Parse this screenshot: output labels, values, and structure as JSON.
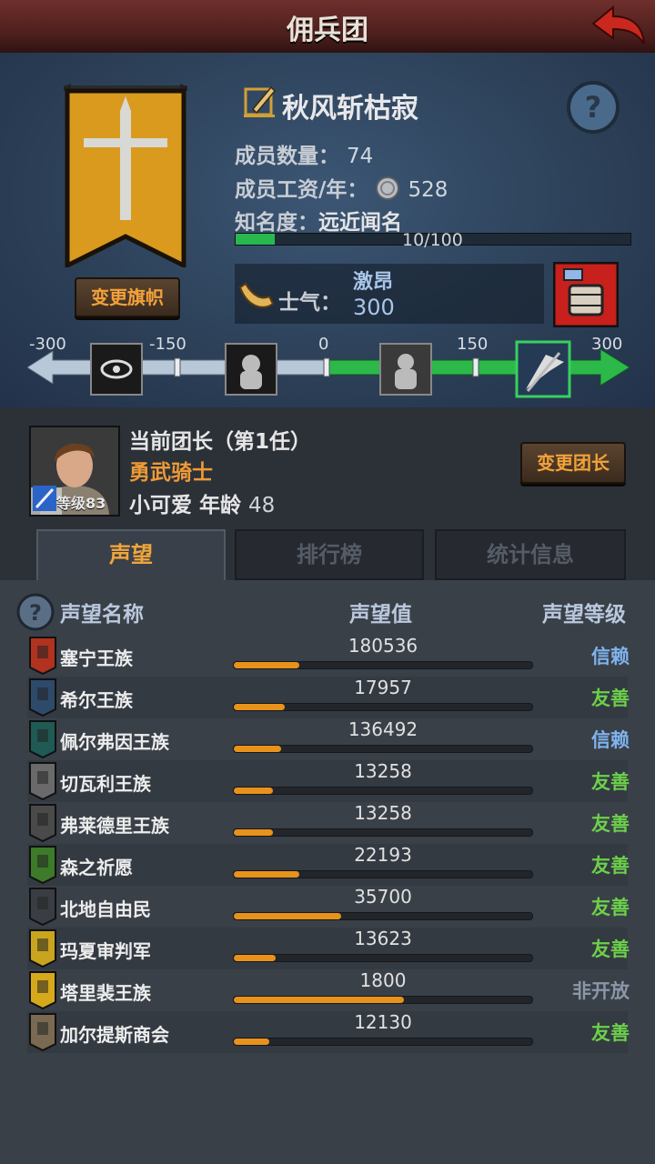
{
  "title": "佣兵团",
  "company": {
    "name": "秋风斩枯寂",
    "change_banner_label": "变更旗帜",
    "members_label": "成员数量：",
    "members_value": "74",
    "wage_label": "成员工资/年：",
    "wage_value": "528",
    "fame_label": "知名度：",
    "fame_value": "远近闻名",
    "fame_progress_text": "10/100",
    "fame_progress": 0.1,
    "morale_label": "士气：",
    "morale_word": "激昂",
    "morale_value": "300"
  },
  "morale_scale": {
    "ticks": [
      "-300",
      "-150",
      "0",
      "150",
      "300"
    ],
    "current": 300,
    "min": -300,
    "max": 300
  },
  "leader": {
    "title": "当前团长（第1任）",
    "class": "勇武骑士",
    "name_age": "小可爱  年龄",
    "age": "48",
    "level_label": "等级83",
    "change_label": "变更团长"
  },
  "tabs": [
    "声望",
    "排行榜",
    "统计信息"
  ],
  "reputation_headers": {
    "name": "声望名称",
    "value": "声望值",
    "level": "声望等级"
  },
  "reputation": [
    {
      "name": "塞宁王族",
      "value": "180536",
      "progress": 0.22,
      "level": "信赖",
      "level_color": "#7fb4ee",
      "icon_color": "#b0321f"
    },
    {
      "name": "希尔王族",
      "value": "17957",
      "progress": 0.17,
      "level": "友善",
      "level_color": "#6cd04a",
      "icon_color": "#2e4a6a"
    },
    {
      "name": "佩尔弗因王族",
      "value": "136492",
      "progress": 0.16,
      "level": "信赖",
      "level_color": "#7fb4ee",
      "icon_color": "#1f5a55"
    },
    {
      "name": "切瓦利王族",
      "value": "13258",
      "progress": 0.13,
      "level": "友善",
      "level_color": "#6cd04a",
      "icon_color": "#6a6a6a"
    },
    {
      "name": "弗莱德里王族",
      "value": "13258",
      "progress": 0.13,
      "level": "友善",
      "level_color": "#6cd04a",
      "icon_color": "#4a4a4a"
    },
    {
      "name": "森之祈愿",
      "value": "22193",
      "progress": 0.22,
      "level": "友善",
      "level_color": "#6cd04a",
      "icon_color": "#3d7a2a"
    },
    {
      "name": "北地自由民",
      "value": "35700",
      "progress": 0.36,
      "level": "友善",
      "level_color": "#6cd04a",
      "icon_color": "#3a3e44"
    },
    {
      "name": "玛夏审判军",
      "value": "13623",
      "progress": 0.14,
      "level": "友善",
      "level_color": "#6cd04a",
      "icon_color": "#c9a41e"
    },
    {
      "name": "塔里裴王族",
      "value": "1800",
      "progress": 0.57,
      "level": "非开放",
      "level_color": "#8a97aa",
      "icon_color": "#d6a81c"
    },
    {
      "name": "加尔提斯商会",
      "value": "12130",
      "progress": 0.12,
      "level": "友善",
      "level_color": "#6cd04a",
      "icon_color": "#7a6a52"
    }
  ]
}
